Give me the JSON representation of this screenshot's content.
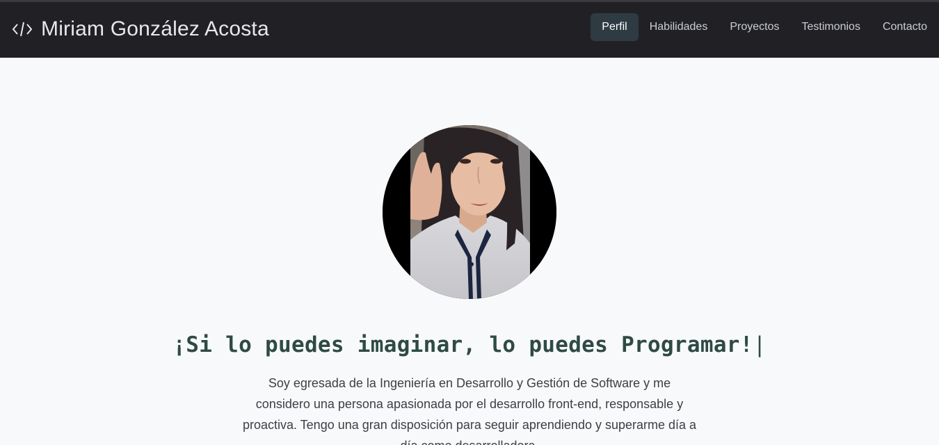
{
  "navbar": {
    "brand_icon": "code-icon",
    "brand_name": "Miriam González Acosta",
    "items": [
      {
        "label": "Perfil",
        "active": true
      },
      {
        "label": "Habilidades",
        "active": false
      },
      {
        "label": "Proyectos",
        "active": false
      },
      {
        "label": "Testimonios",
        "active": false
      },
      {
        "label": "Contacto",
        "active": false
      }
    ]
  },
  "hero": {
    "avatar": "profile-photo",
    "headline": "¡Si lo puedes imaginar, lo puedes Programar!",
    "cursor": "|",
    "intro": "Soy egresada de la Ingeniería en Desarrollo y Gestión de Software y me considero una persona apasionada por el desarrollo front-end, responsable y proactiva. Tengo una gran disposición para seguir aprendiendo y superarme día a día como desarrolladora."
  },
  "colors": {
    "navbar_bg": "#212125",
    "active_nav_bg": "#2f3b43",
    "headline": "#2f4a44",
    "page_bg": "#f8f9fb"
  }
}
